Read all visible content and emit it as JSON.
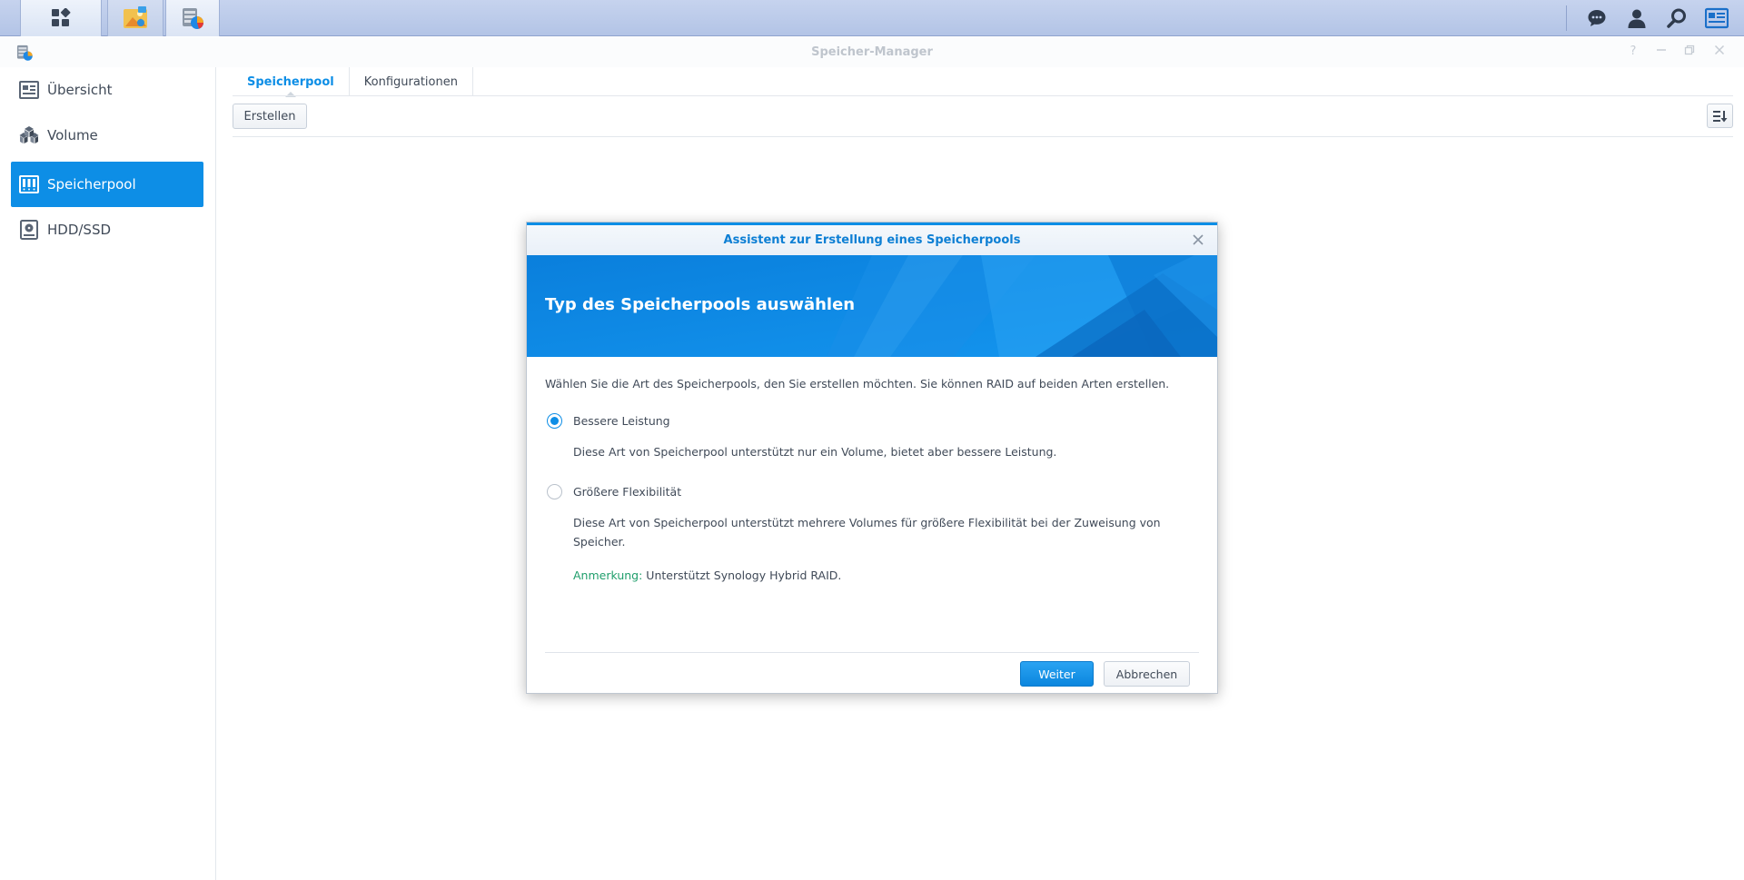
{
  "taskbar": {
    "buttons": [
      {
        "name": "main-menu",
        "icon": "grid-icon"
      },
      {
        "name": "app-photo-station",
        "icon": "photo-app-icon"
      },
      {
        "name": "app-storage-manager",
        "icon": "storage-manager-icon"
      }
    ],
    "right_icons": [
      "chat-icon",
      "user-icon",
      "search-icon",
      "widgets-icon"
    ]
  },
  "window": {
    "title": "Speicher-Manager",
    "controls": [
      "help-icon",
      "minimize-icon",
      "maximize-icon",
      "close-icon"
    ]
  },
  "sidebar": {
    "items": [
      {
        "label": "Übersicht",
        "icon": "overview-icon",
        "active": false
      },
      {
        "label": "Volume",
        "icon": "volume-icon",
        "active": false
      },
      {
        "label": "Speicherpool",
        "icon": "storage-pool-icon",
        "active": true
      },
      {
        "label": "HDD/SSD",
        "icon": "hdd-icon",
        "active": false
      }
    ]
  },
  "main": {
    "tabs": [
      {
        "label": "Speicherpool",
        "active": true
      },
      {
        "label": "Konfigurationen",
        "active": false
      }
    ],
    "toolbar": {
      "create_label": "Erstellen",
      "sort_icon": "sort-icon"
    }
  },
  "dialog": {
    "title": "Assistent zur Erstellung eines Speicherpools",
    "heading": "Typ des Speicherpools auswählen",
    "intro": "Wählen Sie die Art des Speicherpools, den Sie erstellen möchten. Sie können RAID auf beiden Arten erstellen.",
    "options": [
      {
        "label": "Bessere Leistung",
        "selected": true,
        "description": "Diese Art von Speicherpool unterstützt nur ein Volume, bietet aber bessere Leistung."
      },
      {
        "label": "Größere Flexibilität",
        "selected": false,
        "description_line1": "Diese Art von Speicherpool unterstützt mehrere Volumes für größere Flexibilität bei der Zuweisung von",
        "description_line2": "Speicher.",
        "note_label": "Anmerkung:",
        "note_text": " Unterstützt Synology Hybrid RAID."
      }
    ],
    "next_label": "Weiter",
    "cancel_label": "Abbrechen"
  },
  "colors": {
    "accent": "#0d8ee6",
    "note_green": "#1f9e6b",
    "taskbar": "#b9c9e8"
  }
}
